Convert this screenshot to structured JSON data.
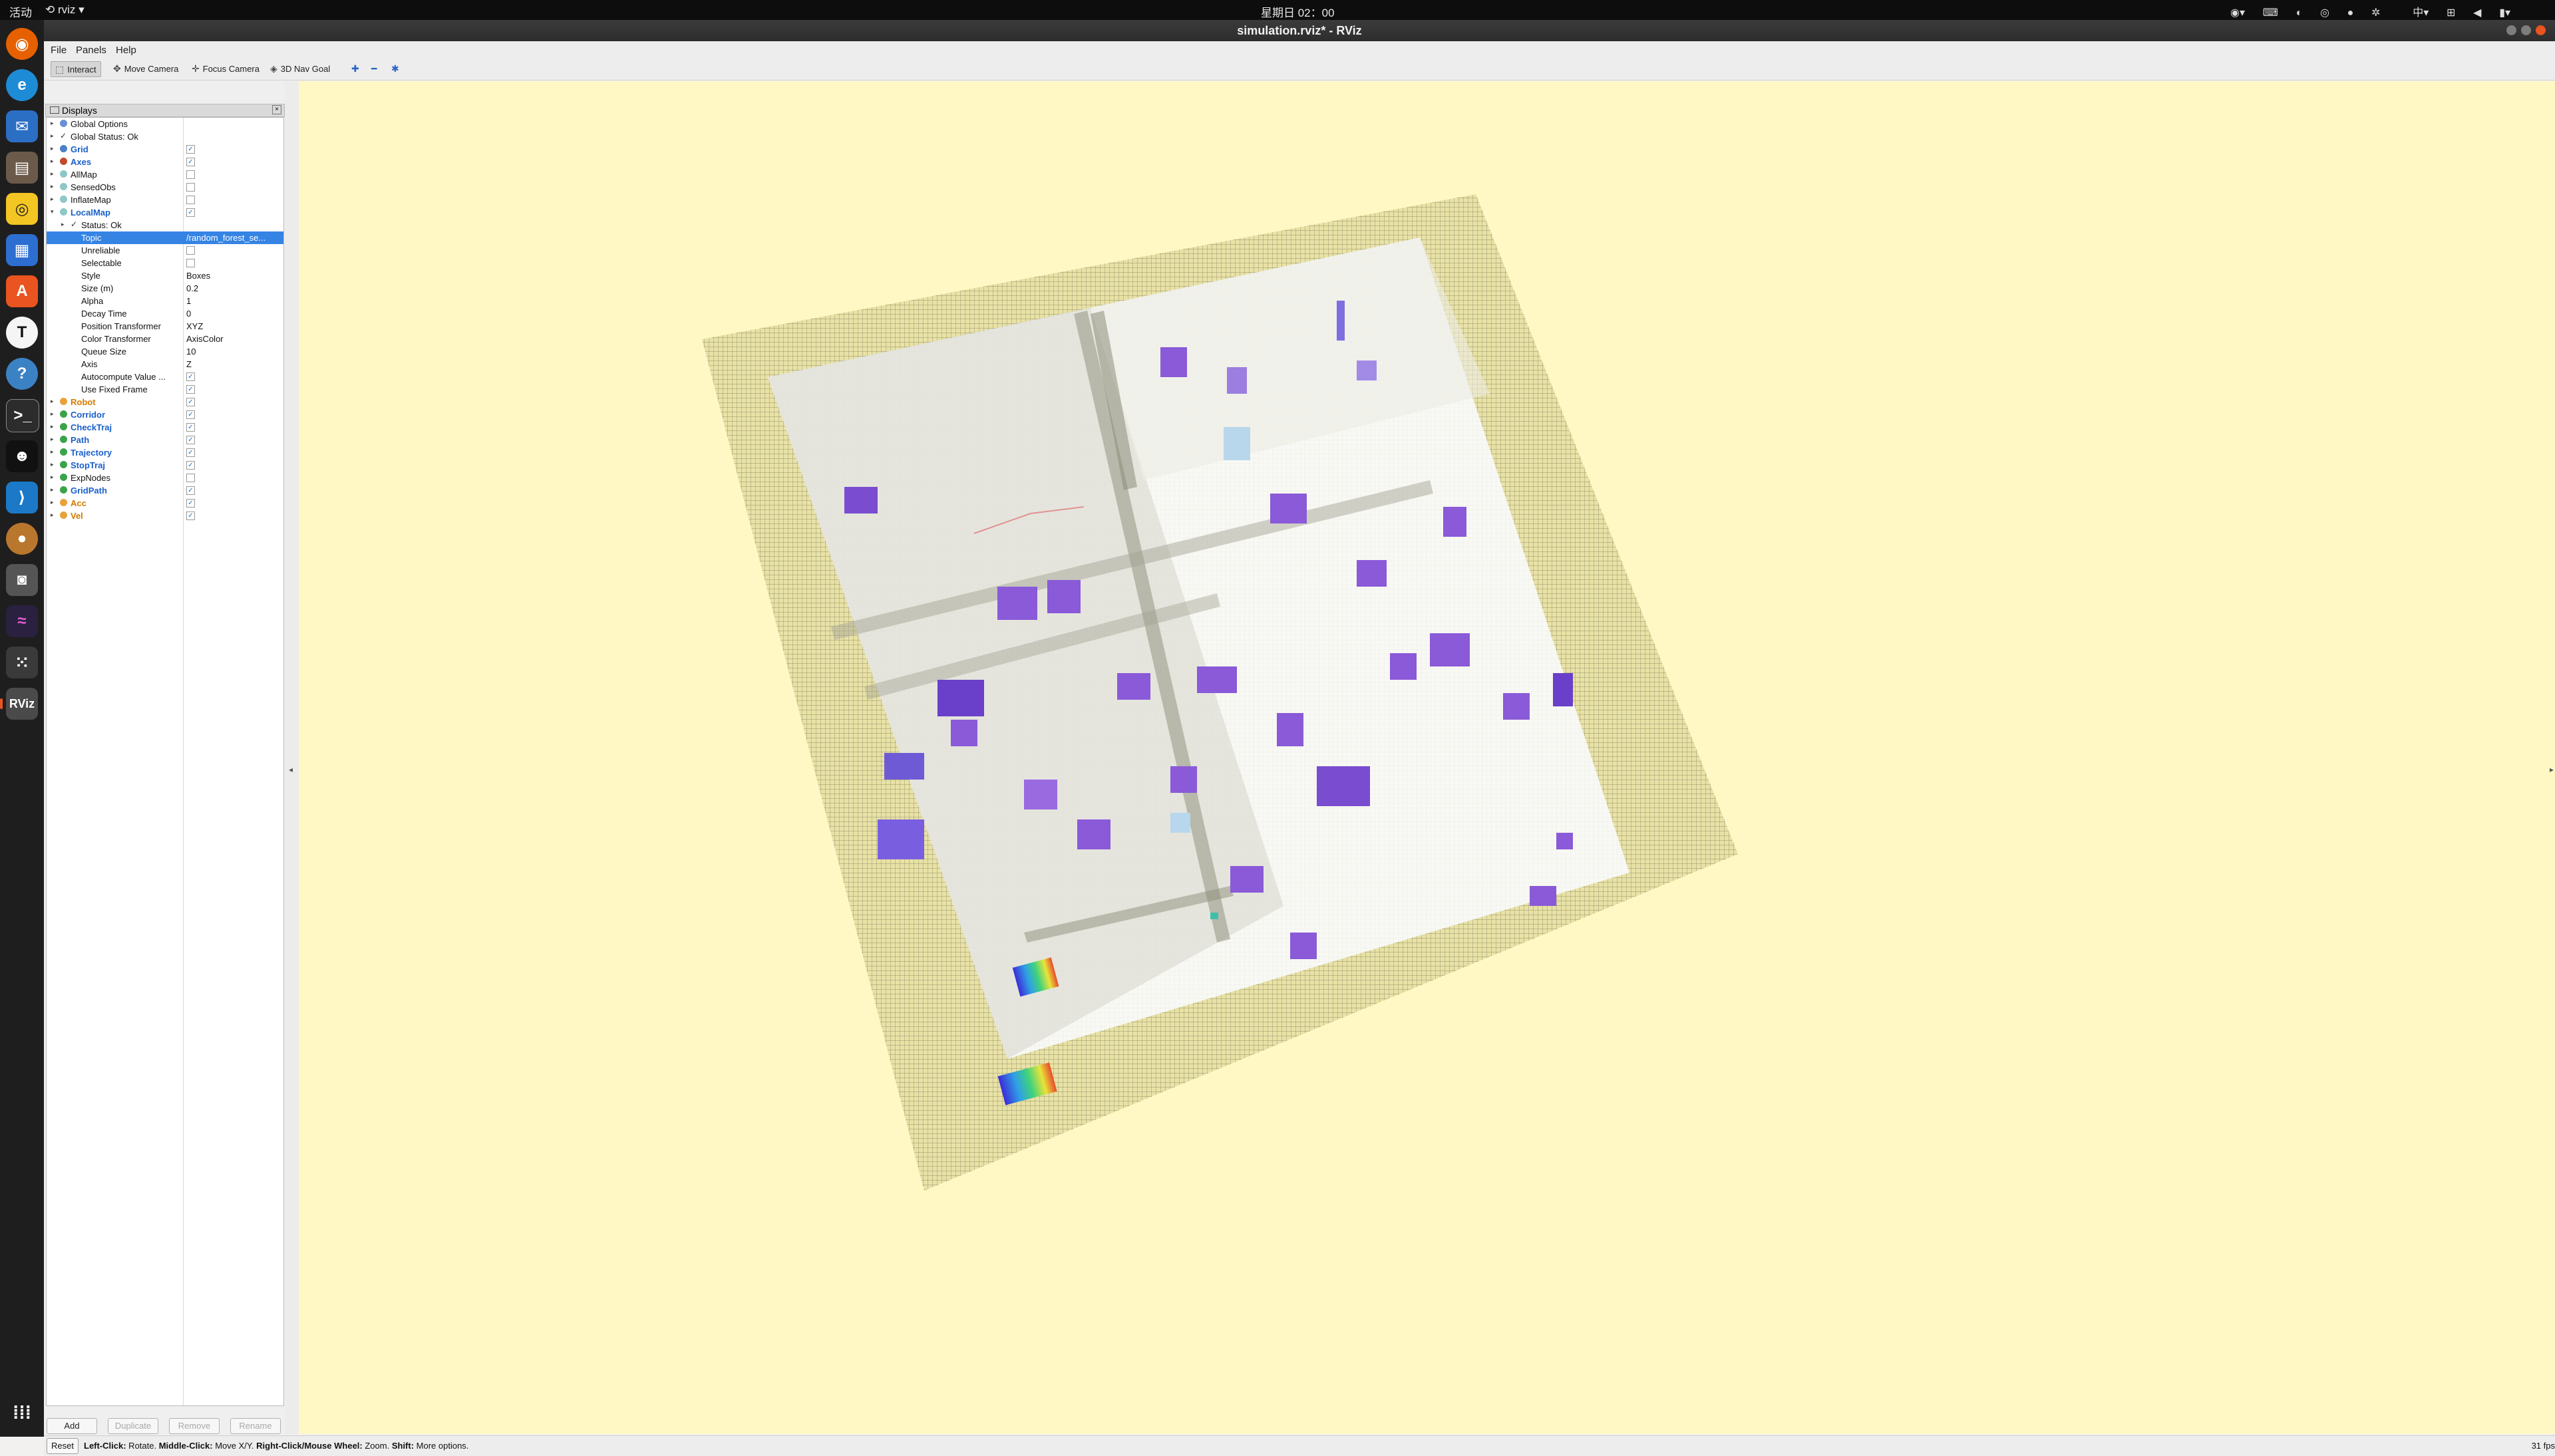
{
  "topbar": {
    "activities": "活动",
    "app_menu": "rviz",
    "clock": "星期日 02：00",
    "input_method": "中"
  },
  "window": {
    "title": "simulation.rviz* - RViz"
  },
  "menu": {
    "file": "File",
    "panels": "Panels",
    "help": "Help"
  },
  "toolbar": {
    "interact": "Interact",
    "move_camera": "Move Camera",
    "focus_camera": "Focus Camera",
    "nav_goal": "3D Nav Goal"
  },
  "panel": {
    "title": "Displays",
    "rows": [
      {
        "name": "Global Options",
        "indent": 0,
        "arrow": "▸",
        "icon": "#6a8fd6",
        "value": "",
        "check": null,
        "style": "normal"
      },
      {
        "name": "Global Status: Ok",
        "indent": 0,
        "arrow": "▸",
        "icon": "check",
        "value": "",
        "check": null,
        "style": "normal"
      },
      {
        "name": "Grid",
        "indent": 0,
        "arrow": "▸",
        "icon": "#4c7ec9",
        "value": "",
        "check": true,
        "style": "blue"
      },
      {
        "name": "Axes",
        "indent": 0,
        "arrow": "▸",
        "icon": "#c04a2a",
        "value": "",
        "check": true,
        "style": "blue"
      },
      {
        "name": "AllMap",
        "indent": 0,
        "arrow": "▸",
        "icon": "#8fc7c7",
        "value": "",
        "check": false,
        "style": "normal"
      },
      {
        "name": "SensedObs",
        "indent": 0,
        "arrow": "▸",
        "icon": "#8fc7c7",
        "value": "",
        "check": false,
        "style": "normal"
      },
      {
        "name": "InflateMap",
        "indent": 0,
        "arrow": "▸",
        "icon": "#8fc7c7",
        "value": "",
        "check": false,
        "style": "normal"
      },
      {
        "name": "LocalMap",
        "indent": 0,
        "arrow": "▾",
        "icon": "#8fc7c7",
        "value": "",
        "check": true,
        "style": "blue"
      },
      {
        "name": "Status: Ok",
        "indent": 1,
        "arrow": "▸",
        "icon": "check",
        "value": "",
        "check": null,
        "style": "normal"
      },
      {
        "name": "Topic",
        "indent": 1,
        "arrow": "",
        "icon": "",
        "value": "/random_forest_se...",
        "check": null,
        "style": "selected"
      },
      {
        "name": "Unreliable",
        "indent": 1,
        "arrow": "",
        "icon": "",
        "value": "",
        "check": false,
        "style": "normal"
      },
      {
        "name": "Selectable",
        "indent": 1,
        "arrow": "",
        "icon": "",
        "value": "",
        "check": false,
        "style": "normal"
      },
      {
        "name": "Style",
        "indent": 1,
        "arrow": "",
        "icon": "",
        "value": "Boxes",
        "check": null,
        "style": "normal"
      },
      {
        "name": "Size (m)",
        "indent": 1,
        "arrow": "",
        "icon": "",
        "value": "0.2",
        "check": null,
        "style": "normal"
      },
      {
        "name": "Alpha",
        "indent": 1,
        "arrow": "",
        "icon": "",
        "value": "1",
        "check": null,
        "style": "normal"
      },
      {
        "name": "Decay Time",
        "indent": 1,
        "arrow": "",
        "icon": "",
        "value": "0",
        "check": null,
        "style": "normal"
      },
      {
        "name": "Position Transformer",
        "indent": 1,
        "arrow": "",
        "icon": "",
        "value": "XYZ",
        "check": null,
        "style": "normal"
      },
      {
        "name": "Color Transformer",
        "indent": 1,
        "arrow": "",
        "icon": "",
        "value": "AxisColor",
        "check": null,
        "style": "normal"
      },
      {
        "name": "Queue Size",
        "indent": 1,
        "arrow": "",
        "icon": "",
        "value": "10",
        "check": null,
        "style": "normal"
      },
      {
        "name": "Axis",
        "indent": 1,
        "arrow": "",
        "icon": "",
        "value": "Z",
        "check": null,
        "style": "normal"
      },
      {
        "name": "Autocompute Value ...",
        "indent": 1,
        "arrow": "",
        "icon": "",
        "value": "",
        "check": true,
        "style": "normal"
      },
      {
        "name": "Use Fixed Frame",
        "indent": 1,
        "arrow": "",
        "icon": "",
        "value": "",
        "check": true,
        "style": "normal"
      },
      {
        "name": "Robot",
        "indent": 0,
        "arrow": "▸",
        "icon": "#e8a23a",
        "value": "",
        "check": true,
        "style": "orange"
      },
      {
        "name": "Corridor",
        "indent": 0,
        "arrow": "▸",
        "icon": "#3aa34a",
        "value": "",
        "check": true,
        "style": "blue"
      },
      {
        "name": "CheckTraj",
        "indent": 0,
        "arrow": "▸",
        "icon": "#3aa34a",
        "value": "",
        "check": true,
        "style": "blue"
      },
      {
        "name": "Path",
        "indent": 0,
        "arrow": "▸",
        "icon": "#3aa34a",
        "value": "",
        "check": true,
        "style": "blue"
      },
      {
        "name": "Trajectory",
        "indent": 0,
        "arrow": "▸",
        "icon": "#3aa34a",
        "value": "",
        "check": true,
        "style": "blue"
      },
      {
        "name": "StopTraj",
        "indent": 0,
        "arrow": "▸",
        "icon": "#3aa34a",
        "value": "",
        "check": true,
        "style": "blue"
      },
      {
        "name": "ExpNodes",
        "indent": 0,
        "arrow": "▸",
        "icon": "#3aa34a",
        "value": "",
        "check": false,
        "style": "normal"
      },
      {
        "name": "GridPath",
        "indent": 0,
        "arrow": "▸",
        "icon": "#3aa34a",
        "value": "",
        "check": true,
        "style": "blue"
      },
      {
        "name": "Acc",
        "indent": 0,
        "arrow": "▸",
        "icon": "#e8a23a",
        "value": "",
        "check": true,
        "style": "orange"
      },
      {
        "name": "Vel",
        "indent": 0,
        "arrow": "▸",
        "icon": "#e8a23a",
        "value": "",
        "check": true,
        "style": "orange"
      }
    ],
    "buttons": {
      "add": "Add",
      "duplicate": "Duplicate",
      "remove": "Remove",
      "rename": "Rename"
    }
  },
  "status": {
    "reset": "Reset",
    "hint_left_key": "Left-Click:",
    "hint_left": " Rotate. ",
    "hint_middle_key": "Middle-Click:",
    "hint_middle": " Move X/Y. ",
    "hint_right_key": "Right-Click/Mouse Wheel:",
    "hint_right": " Zoom. ",
    "hint_shift_key": "Shift:",
    "hint_shift": " More options.",
    "fps": "31 fps"
  },
  "colors": {
    "viewport_bg": "#fff8c5",
    "accent": "#3584e4",
    "dock_accent": "#e95420"
  }
}
